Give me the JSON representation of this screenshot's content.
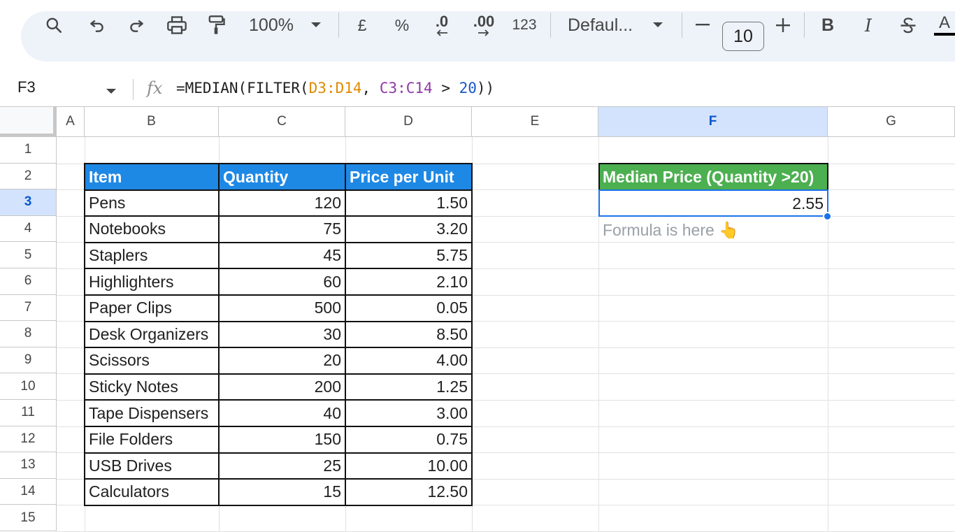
{
  "toolbar": {
    "zoom": "100%",
    "currency": "£",
    "percent": "%",
    "decrease_decimals": ".0",
    "increase_decimals": ".00",
    "number_format": "123",
    "font": "Defaul...",
    "font_size": "10",
    "bold": "B",
    "italic": "I",
    "text_color": "A"
  },
  "formula_bar": {
    "cell_ref": "F3",
    "fx": "fx",
    "formula_parts": [
      "=MEDIAN(FILTER(",
      "D3:D14",
      ", ",
      "C3:C14",
      " > ",
      "20",
      "))"
    ]
  },
  "columns": [
    "A",
    "B",
    "C",
    "D",
    "E",
    "F",
    "G"
  ],
  "rows": [
    "1",
    "2",
    "3",
    "4",
    "5",
    "6",
    "7",
    "8",
    "9",
    "10",
    "11",
    "12",
    "13",
    "14",
    "15"
  ],
  "table": {
    "headers": [
      "Item",
      "Quantity",
      "Price per Unit"
    ],
    "rows": [
      [
        "Pens",
        "120",
        "1.50"
      ],
      [
        "Notebooks",
        "75",
        "3.20"
      ],
      [
        "Staplers",
        "45",
        "5.75"
      ],
      [
        "Highlighters",
        "60",
        "2.10"
      ],
      [
        "Paper Clips",
        "500",
        "0.05"
      ],
      [
        "Desk Organizers",
        "30",
        "8.50"
      ],
      [
        "Scissors",
        "20",
        "4.00"
      ],
      [
        "Sticky Notes",
        "200",
        "1.25"
      ],
      [
        "Tape Dispensers",
        "40",
        "3.00"
      ],
      [
        "File Folders",
        "150",
        "0.75"
      ],
      [
        "USB Drives",
        "25",
        "10.00"
      ],
      [
        "Calculators",
        "15",
        "12.50"
      ]
    ]
  },
  "result": {
    "header": "Median Price (Quantity >20)",
    "value": "2.55",
    "note": "Formula is here 👆"
  },
  "colors": {
    "table_header": "#1e88e5",
    "result_header": "#4caf50",
    "selection": "#1a73e8"
  }
}
